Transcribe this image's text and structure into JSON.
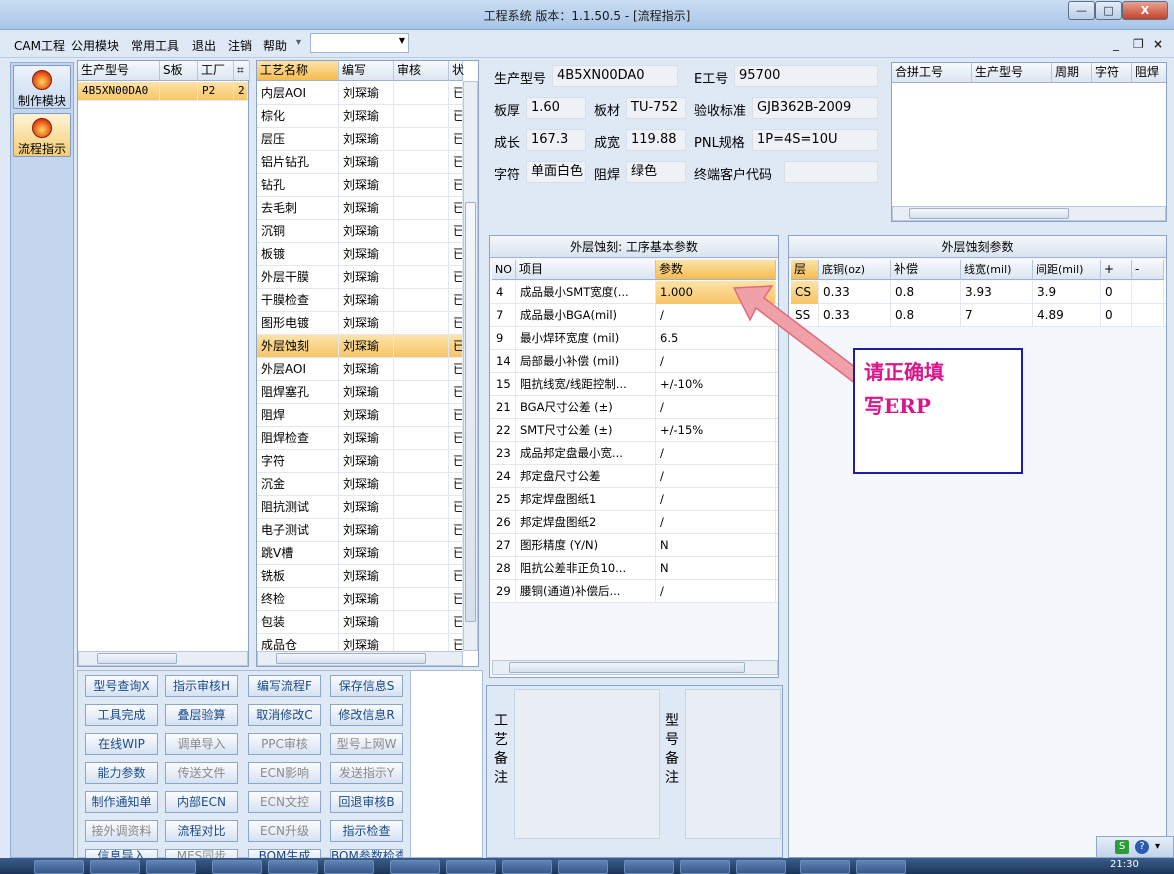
{
  "window": {
    "title": "工程系统  版本：1.1.50.5 - [流程指示]",
    "minimize": "—",
    "maximize": "□",
    "close": "X"
  },
  "menu": {
    "items": [
      "CAM工程",
      "公用模块",
      "常用工具",
      "退出",
      "注销",
      "帮助"
    ],
    "combo_value": "",
    "mdi_min": "_",
    "mdi_restore": "❐",
    "mdi_close": "×"
  },
  "nav": {
    "items": [
      {
        "label": "制作模块",
        "icon": "fire-icon"
      },
      {
        "label": "流程指示",
        "icon": "flow-icon"
      }
    ]
  },
  "model_list": {
    "headers": [
      "生产型号",
      "S板",
      "工厂",
      "⌗"
    ],
    "rows": [
      [
        "4B5XN00DA0",
        "",
        "P2",
        "2"
      ]
    ]
  },
  "process_list": {
    "headers": [
      "工艺名称",
      "编写",
      "审核",
      "状"
    ],
    "rows": [
      [
        "内层AOI",
        "刘琛瑜",
        "",
        "已"
      ],
      [
        "棕化",
        "刘琛瑜",
        "",
        "已"
      ],
      [
        "层压",
        "刘琛瑜",
        "",
        "已"
      ],
      [
        "铝片钻孔",
        "刘琛瑜",
        "",
        "已"
      ],
      [
        "钻孔",
        "刘琛瑜",
        "",
        "已"
      ],
      [
        "去毛刺",
        "刘琛瑜",
        "",
        "已"
      ],
      [
        "沉铜",
        "刘琛瑜",
        "",
        "已"
      ],
      [
        "板镀",
        "刘琛瑜",
        "",
        "已"
      ],
      [
        "外层干膜",
        "刘琛瑜",
        "",
        "已"
      ],
      [
        "干膜检查",
        "刘琛瑜",
        "",
        "已"
      ],
      [
        "图形电镀",
        "刘琛瑜",
        "",
        "已"
      ],
      [
        "外层蚀刻",
        "刘琛瑜",
        "",
        "已"
      ],
      [
        "外层AOI",
        "刘琛瑜",
        "",
        "已"
      ],
      [
        "阻焊塞孔",
        "刘琛瑜",
        "",
        "已"
      ],
      [
        "阻焊",
        "刘琛瑜",
        "",
        "已"
      ],
      [
        "阻焊检查",
        "刘琛瑜",
        "",
        "已"
      ],
      [
        "字符",
        "刘琛瑜",
        "",
        "已"
      ],
      [
        "沉金",
        "刘琛瑜",
        "",
        "已"
      ],
      [
        "阻抗测试",
        "刘琛瑜",
        "",
        "已"
      ],
      [
        "电子测试",
        "刘琛瑜",
        "",
        "已"
      ],
      [
        "跳V槽",
        "刘琛瑜",
        "",
        "已"
      ],
      [
        "铣板",
        "刘琛瑜",
        "",
        "已"
      ],
      [
        "终检",
        "刘琛瑜",
        "",
        "已"
      ],
      [
        "包装",
        "刘琛瑜",
        "",
        "已"
      ],
      [
        "成品仓",
        "刘琛瑜",
        "",
        "已"
      ]
    ],
    "selected_index": 11
  },
  "info": {
    "model_label": "生产型号",
    "model": "4B5XN00DA0",
    "e_label": "E工号",
    "e_no": "95700",
    "thick_label": "板厚",
    "thick": "1.60",
    "mat_label": "板材",
    "mat": "TU-752",
    "std_label": "验收标准",
    "std": "GJB362B-2009",
    "len_label": "成长",
    "len": "167.3",
    "wid_label": "成宽",
    "wid": "119.88",
    "pnl_label": "PNL规格",
    "pnl": "1P=4S=10U",
    "char_label": "字符",
    "char": "单面白色",
    "mask_label": "阻焊",
    "mask": "绿色",
    "cust_label": "终端客户代码",
    "cust": ""
  },
  "combine": {
    "headers": [
      "合拼工号",
      "生产型号",
      "周期",
      "字符",
      "阻焊"
    ]
  },
  "params": {
    "title": "外层蚀刻: 工序基本参数",
    "headers": [
      "NO",
      "项目",
      "参数"
    ],
    "rows": [
      [
        "4",
        "成品最小SMT宽度(...",
        "1.000"
      ],
      [
        "7",
        "成品最小BGA(mil)",
        "/"
      ],
      [
        "9",
        "最小焊环宽度 (mil)",
        "6.5"
      ],
      [
        "14",
        "局部最小补偿 (mil)",
        "/"
      ],
      [
        "15",
        "阻抗线宽/线距控制...",
        "+/-10%"
      ],
      [
        "21",
        "BGA尺寸公差 (±)",
        "/"
      ],
      [
        "22",
        "SMT尺寸公差 (±)",
        "+/-15%"
      ],
      [
        "23",
        "成品邦定盘最小宽...",
        "/"
      ],
      [
        "24",
        "邦定盘尺寸公差",
        "/"
      ],
      [
        "25",
        "邦定焊盘图纸1",
        "/"
      ],
      [
        "26",
        "邦定焊盘图纸2",
        "/"
      ],
      [
        "27",
        "图形精度 (Y/N)",
        "N"
      ],
      [
        "28",
        "阻抗公差非正负10...",
        "N"
      ],
      [
        "29",
        "腰铜(通道)补偿后...",
        "/"
      ]
    ]
  },
  "etch": {
    "title": "外层蚀刻参数",
    "headers": [
      "层",
      "底铜(oz)",
      "补偿",
      "线宽(mil)",
      "间距(mil)",
      "+",
      "-"
    ],
    "rows": [
      [
        "CS",
        "0.33",
        "0.8",
        "3.93",
        "3.9",
        "0",
        ""
      ],
      [
        "SS",
        "0.33",
        "0.8",
        "7",
        "4.89",
        "0",
        ""
      ]
    ]
  },
  "notes": {
    "process_label": [
      "工",
      "艺",
      "备",
      "注"
    ],
    "model_label": [
      "型",
      "号",
      "备",
      "注"
    ]
  },
  "buttons": [
    [
      "型号查询X",
      "指示审核H",
      "编写流程F",
      "保存信息S"
    ],
    [
      "工具完成",
      "叠层验算",
      "取消修改C",
      "修改信息R"
    ],
    [
      "在线WIP",
      "调单导入",
      "PPC审核",
      "型号上网W"
    ],
    [
      "能力参数",
      "传送文件",
      "ECN影响",
      "发送指示Y"
    ],
    [
      "制作通知单",
      "内部ECN",
      "ECN文控",
      "回退审核B"
    ],
    [
      "接外调资料",
      "流程对比",
      "ECN升级",
      "指示检查"
    ],
    [
      "信息导入",
      "MES同步",
      "BOM生成",
      "BOM参数检查"
    ]
  ],
  "disabled_buttons": [
    "调单导入",
    "PPC审核",
    "型号上网W",
    "传送文件",
    "ECN影响",
    "发送指示Y",
    "ECN文控",
    "接外调资料",
    "ECN升级",
    "MES同步"
  ],
  "callout": {
    "line1": "请正确填",
    "line2": "写ERP",
    "color": "#d9158a"
  },
  "taskbar": {
    "clock": "21:30",
    "tray_s": "S",
    "tray_help": "?"
  }
}
